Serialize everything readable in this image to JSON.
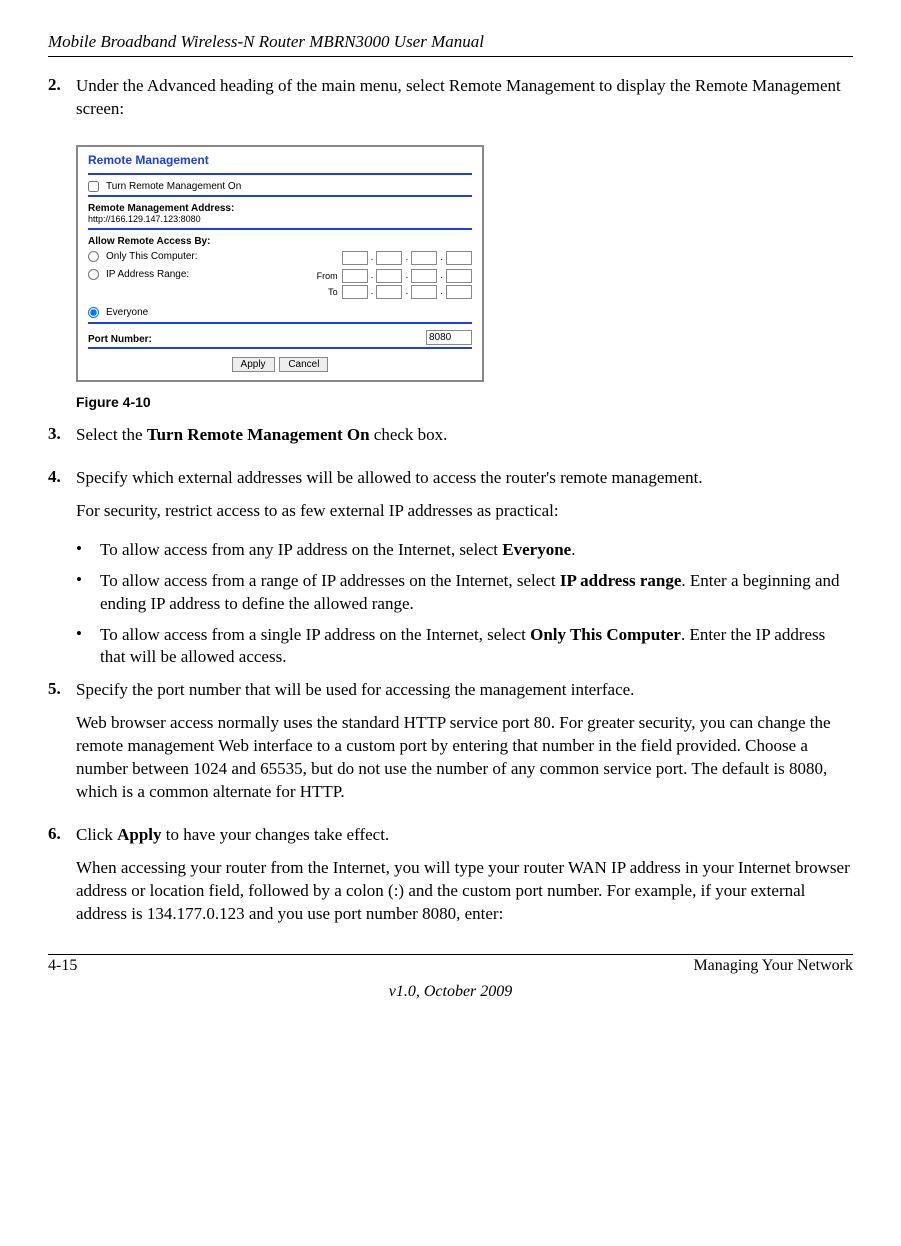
{
  "header": {
    "title": "Mobile Broadband Wireless-N Router MBRN3000 User Manual"
  },
  "steps": {
    "s2": {
      "num": "2.",
      "text": "Under the Advanced heading of the main menu, select Remote Management to display the Remote Management screen:"
    },
    "s3": {
      "num": "3.",
      "prefix": "Select the ",
      "bold": "Turn Remote Management On",
      "suffix": " check box."
    },
    "s4": {
      "num": "4.",
      "line1": "Specify which external addresses will be allowed to access the router's remote management.",
      "line2": "For security, restrict access to as few external IP addresses as practical:",
      "b1_prefix": "To allow access from any IP address on the Internet, select ",
      "b1_bold": "Everyone",
      "b1_suffix": ".",
      "b2_prefix": "To allow access from a range of IP addresses on the Internet, select ",
      "b2_bold": "IP address range",
      "b2_suffix": ". Enter a beginning and ending IP address to define the allowed range.",
      "b3_prefix": "To allow access from a single IP address on the Internet, select ",
      "b3_bold": "Only This Computer",
      "b3_suffix": ". Enter the IP address that will be allowed access."
    },
    "s5": {
      "num": "5.",
      "line1": "Specify the port number that will be used for accessing the management interface.",
      "line2": "Web browser access normally uses the standard HTTP service port 80. For greater security, you can change the remote management Web interface to a custom port by entering that number in the field provided. Choose a number between 1024 and 65535, but do not use the number of any common service port. The default is 8080, which is a common alternate for HTTP."
    },
    "s6": {
      "num": "6.",
      "line1_prefix": "Click ",
      "line1_bold": "Apply",
      "line1_suffix": " to have your changes take effect.",
      "line2": "When accessing your router from the Internet, you will type your router WAN IP address in your Internet browser address or location field, followed by a colon (:) and the custom port number. For example, if your external address is 134.177.0.123 and you use port number 8080, enter:"
    }
  },
  "figure": {
    "caption": "Figure 4-10"
  },
  "panel": {
    "title": "Remote Management",
    "turn_on_label": "Turn Remote Management On",
    "address_heading": "Remote Management Address:",
    "address_value": "http://166.129.147.123:8080",
    "allow_heading": "Allow Remote Access By:",
    "only_this": "Only This Computer:",
    "ip_range": "IP Address Range:",
    "from_label": "From",
    "to_label": "To",
    "everyone": "Everyone",
    "port_label": "Port Number:",
    "port_value": "8080",
    "apply": "Apply",
    "cancel": "Cancel"
  },
  "footer": {
    "page": "4-15",
    "section": "Managing Your Network",
    "version": "v1.0, October 2009"
  }
}
